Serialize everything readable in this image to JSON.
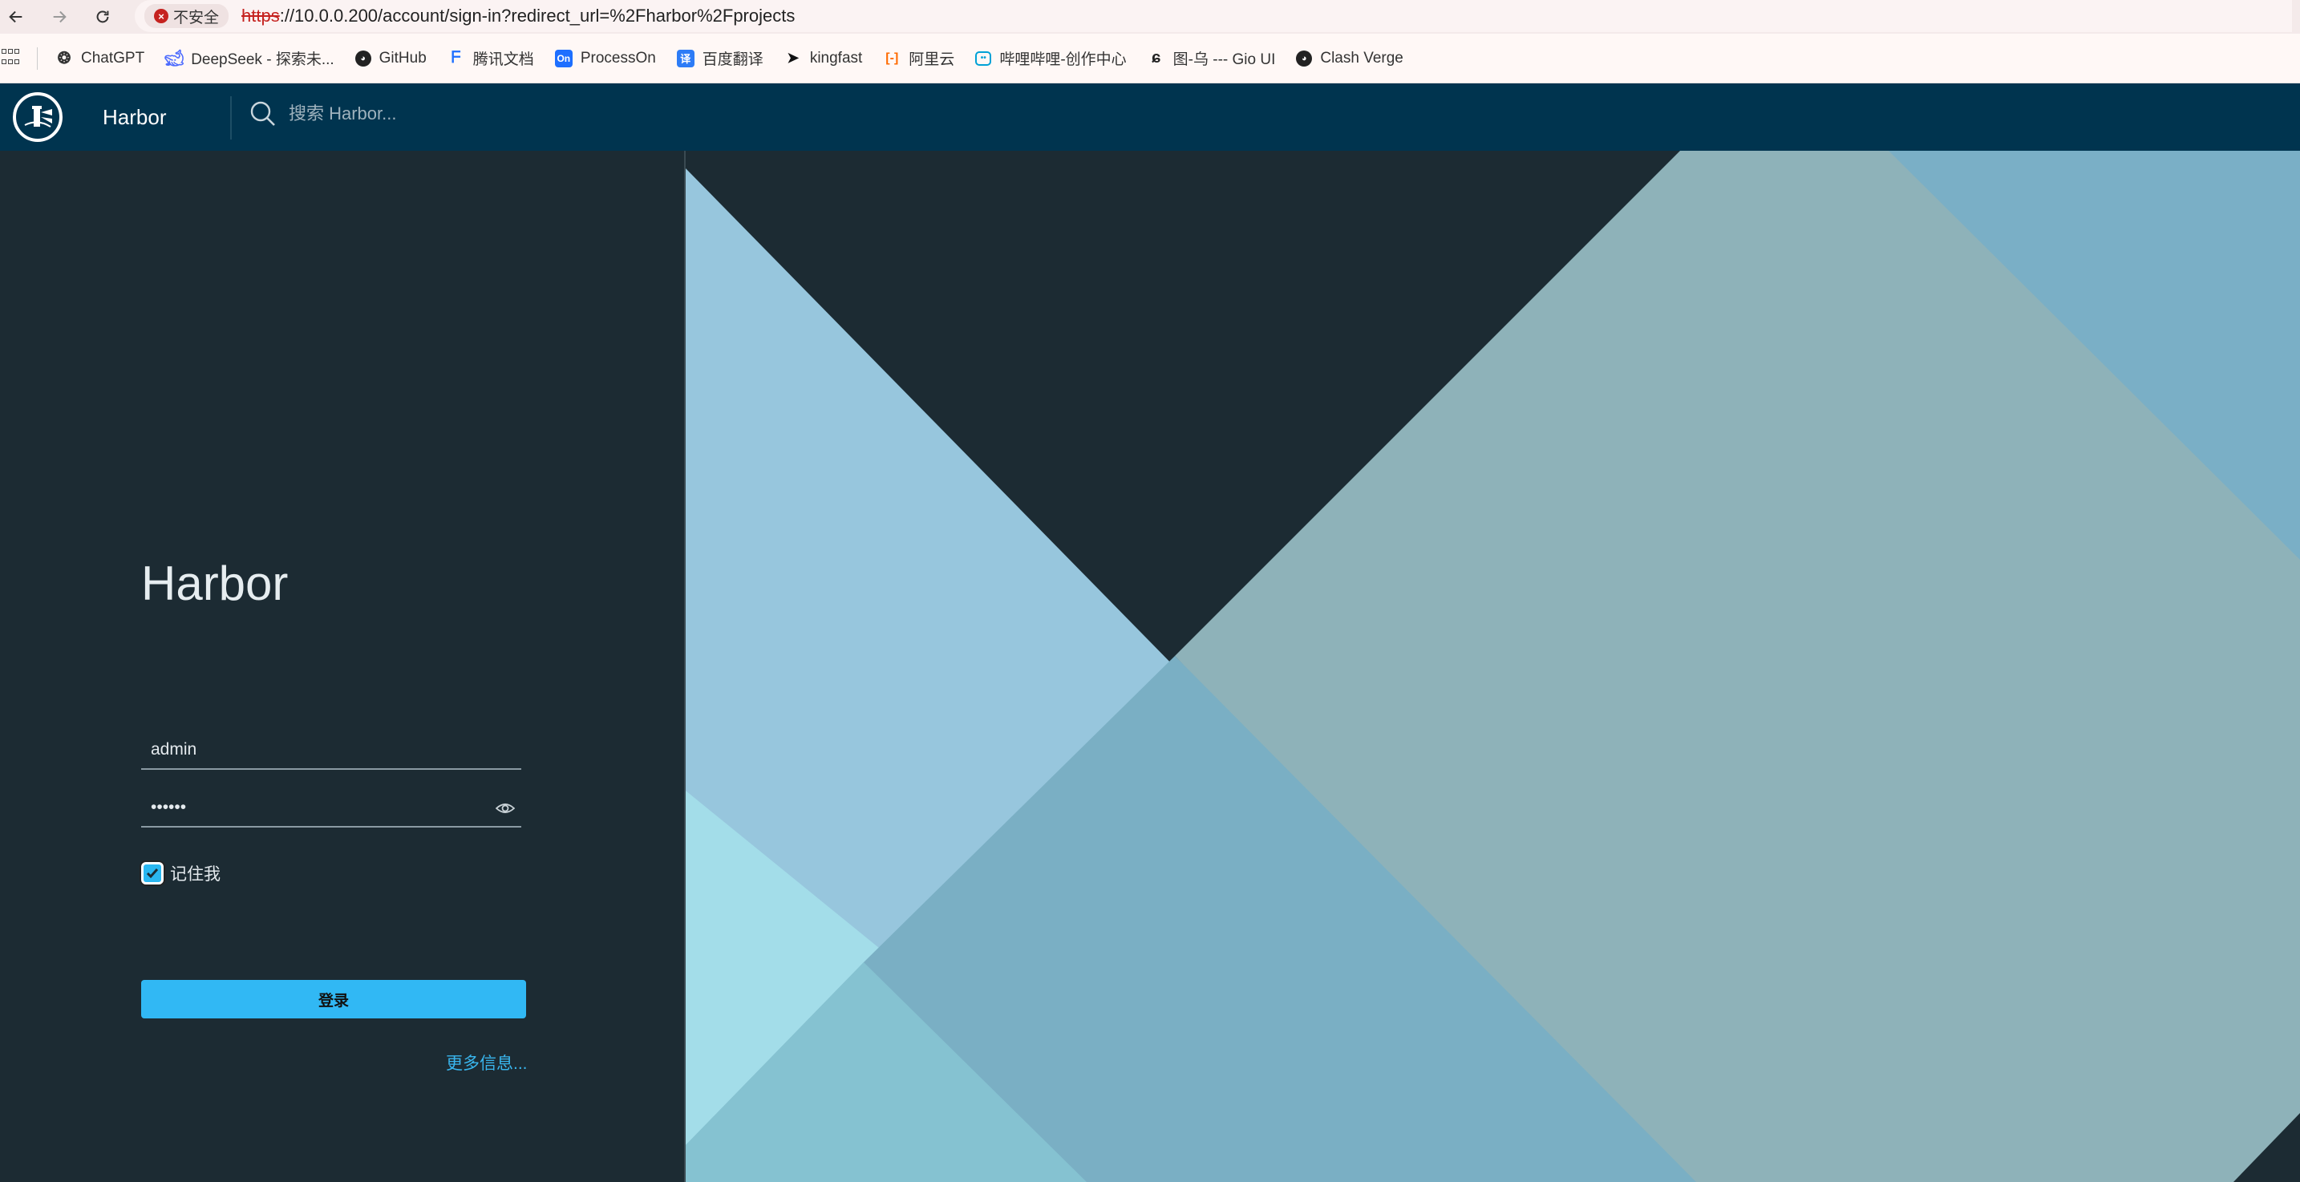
{
  "browser": {
    "security_label": "不安全",
    "url_scheme": "https",
    "url_rest": "://10.0.0.200/account/sign-in?redirect_url=%2Fharbor%2Fprojects"
  },
  "bookmarks": [
    {
      "label": "ChatGPT",
      "icon": "chatgpt-icon"
    },
    {
      "label": "DeepSeek - 探索未...",
      "icon": "deepseek-icon"
    },
    {
      "label": "GitHub",
      "icon": "github-icon"
    },
    {
      "label": "腾讯文档",
      "icon": "tencent-docs-icon"
    },
    {
      "label": "ProcessOn",
      "icon": "processon-icon"
    },
    {
      "label": "百度翻译",
      "icon": "baidu-translate-icon"
    },
    {
      "label": "kingfast",
      "icon": "cursor-icon"
    },
    {
      "label": "阿里云",
      "icon": "aliyun-icon"
    },
    {
      "label": "哔哩哔哩-创作中心",
      "icon": "bilibili-icon"
    },
    {
      "label": "图-乌 --- Gio UI",
      "icon": "gio-icon"
    },
    {
      "label": "Clash Verge",
      "icon": "github-icon"
    }
  ],
  "header": {
    "brand": "Harbor",
    "search_placeholder": "搜索 Harbor..."
  },
  "login": {
    "title": "Harbor",
    "username_value": "admin",
    "password_value": "••••••",
    "remember_label": "记住我",
    "remember_checked": true,
    "login_button": "登录",
    "more_info": "更多信息..."
  },
  "colors": {
    "header_bg": "#00344f",
    "panel_bg": "#1c2b33",
    "accent": "#31b8f4"
  }
}
